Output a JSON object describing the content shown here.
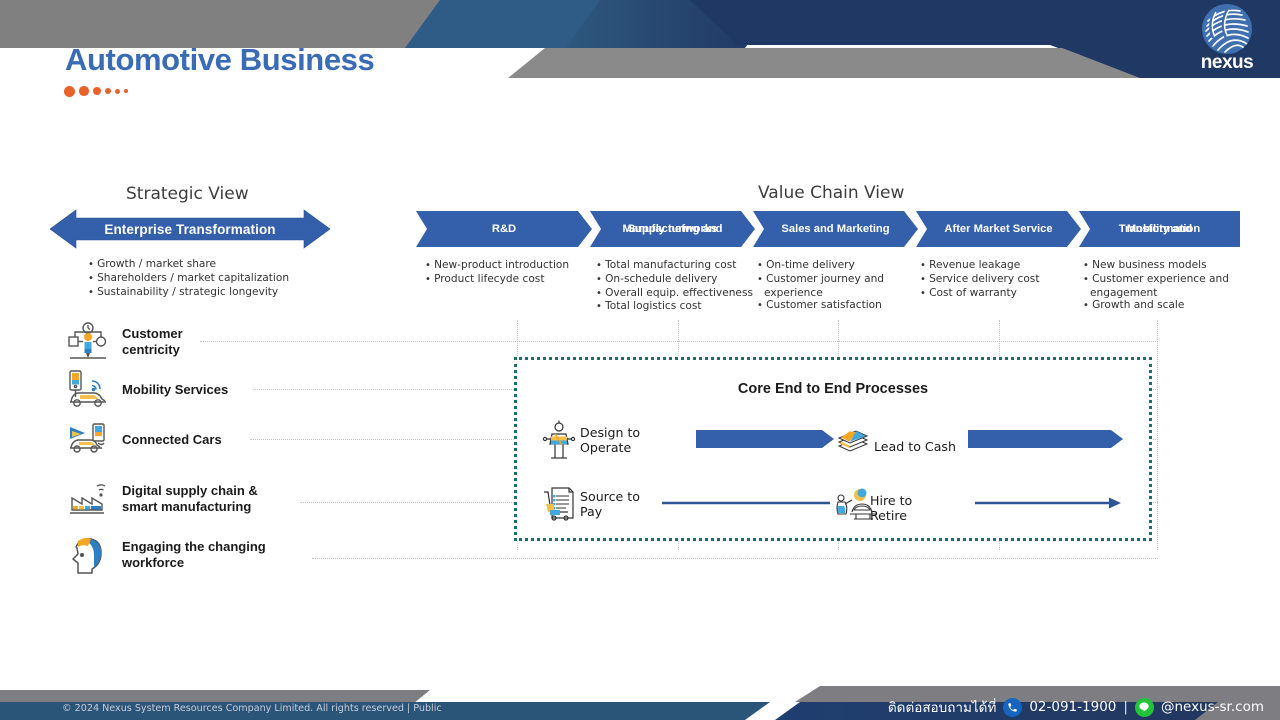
{
  "brand": {
    "logo_name": "nexus-logo",
    "logo_text": "nexus",
    "accent_blue": "#3a6cb5",
    "chevron_blue": "#3460ab",
    "dot_orange": "#e8622a",
    "core_box_border": "#1f6b72",
    "header_gray": "#808080",
    "header_navy": "#1f3864"
  },
  "title": "Automotive Business",
  "sections": {
    "strategic_view_title": "Strategic View",
    "value_chain_title": "Value Chain View"
  },
  "strategic": {
    "arrow_label": "Enterprise Transformation",
    "bullets": [
      "Growth / market share",
      "Shareholders / market capitalization",
      "Sustainability / strategic longevity"
    ]
  },
  "value_chain": [
    {
      "stage": "R&D",
      "bullets": [
        "New-product introduction",
        "Product lifecyde cost"
      ]
    },
    {
      "stage": "Manufacturing and Supply networks",
      "stage_line1": "Manufacturing and",
      "stage_line2": "Supply networks",
      "bullets": [
        "Total manufacturing cost",
        "On-schedule delivery",
        "Overall equip. effectiveness",
        "Total logistics cost"
      ]
    },
    {
      "stage": "Sales and Marketing",
      "bullets": [
        "On-time delivery",
        "Customer journey and",
        "experience",
        "Customer satisfaction"
      ]
    },
    {
      "stage": "After Market Service",
      "bullets": [
        "Revenue leakage",
        "Service delivery cost",
        "Cost of warranty"
      ]
    },
    {
      "stage": "Mobility and Transformation",
      "stage_line1": "Mobility and",
      "stage_line2": "Transformation",
      "bullets": [
        "New business models",
        "Customer experience and",
        "engagement",
        "Growth and scale"
      ]
    }
  ],
  "capabilities": [
    {
      "icon": "customer-centricity-icon",
      "line1": "Customer",
      "line2": "centricity"
    },
    {
      "icon": "mobility-services-icon",
      "line1": "Mobility Services",
      "line2": ""
    },
    {
      "icon": "connected-cars-icon",
      "line1": "Connected Cars",
      "line2": ""
    },
    {
      "icon": "digital-supply-chain-icon",
      "line1": "Digital supply chain &",
      "line2": "smart manufacturing"
    },
    {
      "icon": "engaging-workforce-icon",
      "line1": "Engaging the changing",
      "line2": "workforce"
    }
  ],
  "core_processes": {
    "title": "Core End to End Processes",
    "items": [
      {
        "icon": "design-to-operate-icon",
        "line1": "Design to",
        "line2": "Operate"
      },
      {
        "icon": "lead-to-cash-icon",
        "line1": "Lead to Cash",
        "line2": ""
      },
      {
        "icon": "source-to-pay-icon",
        "line1": "Source to",
        "line2": "Pay"
      },
      {
        "icon": "hire-to-retire-icon",
        "line1": "Hire to",
        "line2": "Retire"
      }
    ]
  },
  "footer": {
    "copyright": "© 2024 Nexus System Resources Company Limited. All rights reserved | Public",
    "contact_label": "ติดต่อสอบถามได้ที่",
    "phone": "02-091-1900",
    "separator": "|",
    "line_id": "@nexus-sr.com"
  }
}
